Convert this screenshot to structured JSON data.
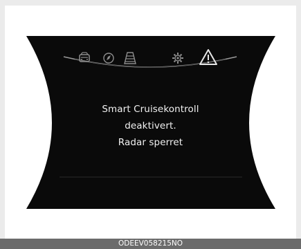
{
  "display": {
    "message_lines": [
      "Smart Cruisekontroll",
      "deaktivert.",
      "Radar sperret"
    ]
  },
  "tab_icons": [
    {
      "name": "car-icon"
    },
    {
      "name": "navigation-compass-icon"
    },
    {
      "name": "lane-road-icon"
    },
    {
      "name": "settings-gear-icon"
    },
    {
      "name": "warning-triangle-icon",
      "active": true
    }
  ],
  "caption": {
    "code": "ODEEV058215NO"
  },
  "colors": {
    "display_bg": "#0a0a0a",
    "text": "#f2f2f2",
    "icon_inactive": "#8e8e8e",
    "icon_active": "#e6e6e6",
    "caption_bar": "#6b6b6b",
    "page_bg": "#ffffff"
  }
}
